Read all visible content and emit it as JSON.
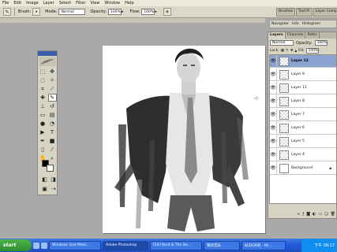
{
  "menu": [
    "File",
    "Edit",
    "Image",
    "Layer",
    "Select",
    "Filter",
    "View",
    "Window",
    "Help"
  ],
  "options": {
    "brush_label": "Brush:",
    "mode_label": "Mode:",
    "mode_value": "Normal",
    "opacity_label": "Opacity:",
    "opacity_value": "100%",
    "flow_label": "Flow:",
    "flow_value": "100%"
  },
  "palette_well": [
    "Brushes",
    "Tool Pr",
    "Layer Comps"
  ],
  "panel_top": [
    "Navigator",
    "Info",
    "Histogram"
  ],
  "layers_panel": {
    "tabs": [
      "Layers",
      "Channels",
      "Paths"
    ],
    "blend_mode": "Normal",
    "opacity_label": "Opacity:",
    "opacity_value": "100%",
    "lock_label": "Lock:",
    "fill_label": "Fill:",
    "fill_value": "100%",
    "layers": [
      {
        "name": "Layer 12",
        "selected": true
      },
      {
        "name": "Layer 9",
        "selected": false
      },
      {
        "name": "Layer 11",
        "selected": false
      },
      {
        "name": "Layer 8",
        "selected": false
      },
      {
        "name": "Layer 7",
        "selected": false
      },
      {
        "name": "Layer 6",
        "selected": false
      },
      {
        "name": "Layer 5",
        "selected": false
      },
      {
        "name": "Layer 4",
        "selected": false
      },
      {
        "name": "Background",
        "selected": false,
        "locked": true
      }
    ]
  },
  "taskbar": {
    "start": "start",
    "tasks": [
      {
        "label": "Windows Live Mess...",
        "active": false
      },
      {
        "label": "Adobe Photoshop",
        "active": true
      },
      {
        "label": "[2G] Kord & The Ge...",
        "active": false
      },
      {
        "label": "我的音乐",
        "active": false
      },
      {
        "label": "KEDOR的 - Mi...",
        "active": false
      }
    ],
    "clock": "下午 09:17"
  },
  "colors": {
    "menubar": "#ece9d8",
    "workspace": "#a9a9a9",
    "selection": "#8aa3d1",
    "taskbar": "#245edb"
  }
}
